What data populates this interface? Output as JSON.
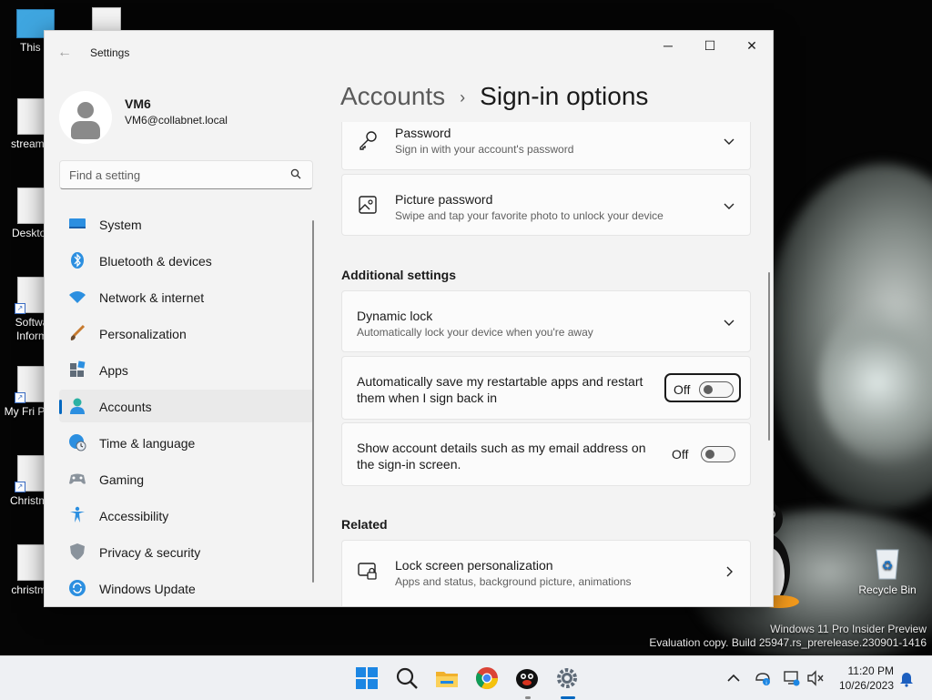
{
  "desktop": {
    "icons": [
      {
        "label": "This P"
      },
      {
        "label": "streamin"
      },
      {
        "label": "Desktop"
      },
      {
        "label": "Softwa Inform"
      },
      {
        "label": "My Fri Ping"
      },
      {
        "label": "Christma"
      },
      {
        "label": "christma"
      }
    ],
    "recycle_bin": "Recycle Bin",
    "watermark_line1": "Windows 11 Pro Insider Preview",
    "watermark_line2": "Evaluation copy. Build 25947.rs_prerelease.230901-1416"
  },
  "window": {
    "title": "Settings",
    "back_icon": "back-arrow-icon",
    "controls": {
      "minimize": "─",
      "maximize": "☐",
      "close": "✕"
    }
  },
  "profile": {
    "name": "VM6",
    "email": "VM6@collabnet.local"
  },
  "search": {
    "placeholder": "Find a setting"
  },
  "nav": {
    "items": [
      {
        "label": "System",
        "icon": "system-icon"
      },
      {
        "label": "Bluetooth & devices",
        "icon": "bluetooth-icon"
      },
      {
        "label": "Network & internet",
        "icon": "network-icon"
      },
      {
        "label": "Personalization",
        "icon": "brush-icon"
      },
      {
        "label": "Apps",
        "icon": "apps-icon"
      },
      {
        "label": "Accounts",
        "icon": "accounts-icon",
        "active": true
      },
      {
        "label": "Time & language",
        "icon": "globe-clock-icon"
      },
      {
        "label": "Gaming",
        "icon": "gamepad-icon"
      },
      {
        "label": "Accessibility",
        "icon": "accessibility-icon"
      },
      {
        "label": "Privacy & security",
        "icon": "shield-icon"
      },
      {
        "label": "Windows Update",
        "icon": "update-icon"
      }
    ]
  },
  "breadcrumb": {
    "parent": "Accounts",
    "separator": "›",
    "current": "Sign-in options"
  },
  "cards": {
    "password": {
      "title": "Password",
      "desc": "Sign in with your account's password"
    },
    "picture_password": {
      "title": "Picture password",
      "desc": "Swipe and tap your favorite photo to unlock your device"
    }
  },
  "additional_settings": {
    "heading": "Additional settings",
    "dynamic_lock": {
      "title": "Dynamic lock",
      "desc": "Automatically lock your device when you're away"
    },
    "restart_apps": {
      "line1": "Automatically save my restartable apps and restart",
      "line2": "them when I sign back in",
      "state": "Off"
    },
    "account_details": {
      "line1": "Show account details such as my email address on",
      "line2": "the sign-in screen.",
      "state": "Off"
    }
  },
  "related": {
    "heading": "Related",
    "lock_screen": {
      "title": "Lock screen personalization",
      "desc": "Apps and status, background picture, animations"
    }
  },
  "taskbar": {
    "apps": [
      "start-icon",
      "search-icon",
      "file-explorer-icon",
      "chrome-icon",
      "pingu-app-icon",
      "settings-icon"
    ],
    "time": "11:20 PM",
    "date": "10/26/2023"
  },
  "colors": {
    "accent": "#0067c0"
  }
}
